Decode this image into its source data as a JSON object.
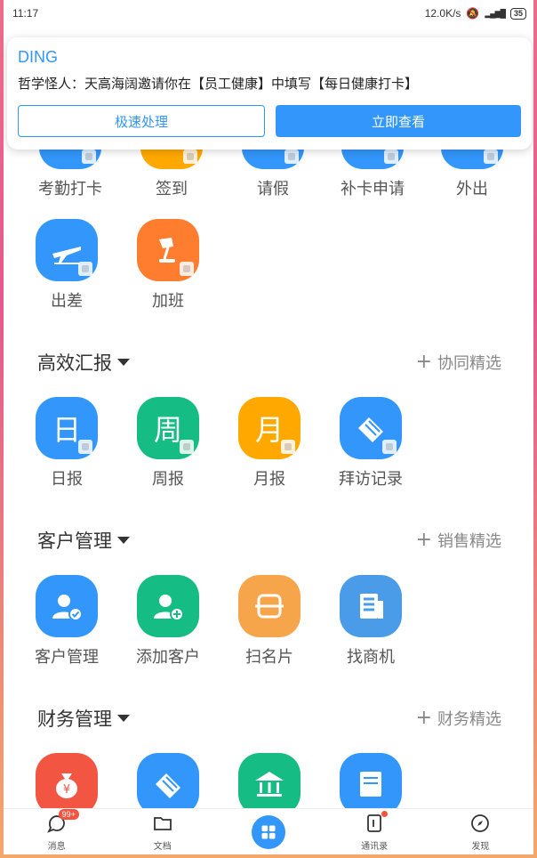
{
  "status": {
    "time": "11:17",
    "speed": "12.0K/s",
    "battery": "35"
  },
  "notification": {
    "title": "DING",
    "message": "哲学怪人：天高海阔邀请你在【员工健康】中填写【每日健康打卡】",
    "btn_quick": "极速处理",
    "btn_view": "立即查看"
  },
  "attendance": {
    "items": [
      {
        "label": "考勤打卡",
        "color": "#3296fa"
      },
      {
        "label": "签到",
        "color": "#ffa800"
      },
      {
        "label": "请假",
        "color": "#3296fa"
      },
      {
        "label": "补卡申请",
        "color": "#3296fa"
      },
      {
        "label": "外出",
        "color": "#3296fa"
      },
      {
        "label": "出差",
        "color": "#3296fa",
        "icon": "airplane-icon"
      },
      {
        "label": "加班",
        "color": "#ff7d2f",
        "icon": "desk-lamp-icon"
      }
    ]
  },
  "reports": {
    "title": "高效汇报",
    "link": "协同精选",
    "items": [
      {
        "label": "日报",
        "glyph": "日",
        "color": "#3296fa"
      },
      {
        "label": "周报",
        "glyph": "周",
        "color": "#15bc83"
      },
      {
        "label": "月报",
        "glyph": "月",
        "color": "#ffa800"
      },
      {
        "label": "拜访记录",
        "color": "#3296fa",
        "icon": "handshake-icon"
      }
    ]
  },
  "customers": {
    "title": "客户管理",
    "link": "销售精选",
    "items": [
      {
        "label": "客户管理",
        "color": "#3296fa",
        "icon": "customer-check-icon"
      },
      {
        "label": "添加客户",
        "color": "#15bc83",
        "icon": "add-customer-icon"
      },
      {
        "label": "扫名片",
        "color": "#f7a54a",
        "icon": "scan-card-icon"
      },
      {
        "label": "找商机",
        "color": "#4a9ce8",
        "icon": "building-icon"
      }
    ]
  },
  "finance": {
    "title": "财务管理",
    "link": "财务精选",
    "items": [
      {
        "color": "#f25643",
        "icon": "money-bag-icon"
      },
      {
        "color": "#3296fa",
        "icon": "handshake-icon"
      },
      {
        "color": "#15bc83",
        "icon": "bank-icon"
      },
      {
        "color": "#3296fa",
        "icon": "invoice-icon"
      }
    ]
  },
  "nav": {
    "messages": "消息",
    "messages_badge": "99+",
    "docs": "文档",
    "contacts": "通讯录",
    "discover": "发现"
  }
}
